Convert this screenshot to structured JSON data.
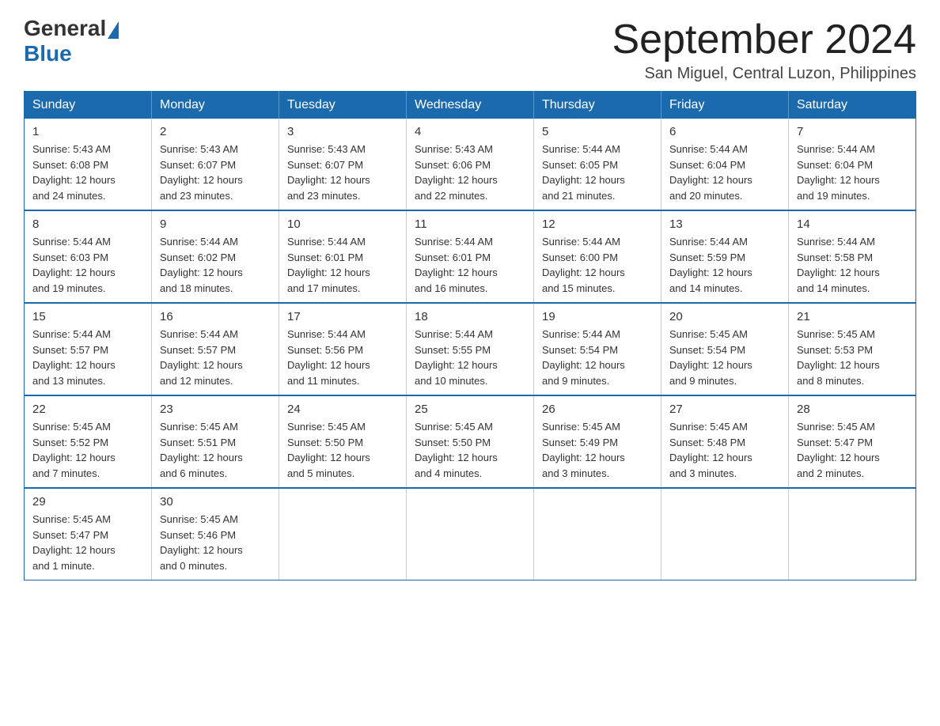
{
  "logo": {
    "general": "General",
    "blue": "Blue"
  },
  "title": "September 2024",
  "location": "San Miguel, Central Luzon, Philippines",
  "weekdays": [
    "Sunday",
    "Monday",
    "Tuesday",
    "Wednesday",
    "Thursday",
    "Friday",
    "Saturday"
  ],
  "weeks": [
    [
      {
        "day": "1",
        "sunrise": "5:43 AM",
        "sunset": "6:08 PM",
        "daylight": "12 hours and 24 minutes."
      },
      {
        "day": "2",
        "sunrise": "5:43 AM",
        "sunset": "6:07 PM",
        "daylight": "12 hours and 23 minutes."
      },
      {
        "day": "3",
        "sunrise": "5:43 AM",
        "sunset": "6:07 PM",
        "daylight": "12 hours and 23 minutes."
      },
      {
        "day": "4",
        "sunrise": "5:43 AM",
        "sunset": "6:06 PM",
        "daylight": "12 hours and 22 minutes."
      },
      {
        "day": "5",
        "sunrise": "5:44 AM",
        "sunset": "6:05 PM",
        "daylight": "12 hours and 21 minutes."
      },
      {
        "day": "6",
        "sunrise": "5:44 AM",
        "sunset": "6:04 PM",
        "daylight": "12 hours and 20 minutes."
      },
      {
        "day": "7",
        "sunrise": "5:44 AM",
        "sunset": "6:04 PM",
        "daylight": "12 hours and 19 minutes."
      }
    ],
    [
      {
        "day": "8",
        "sunrise": "5:44 AM",
        "sunset": "6:03 PM",
        "daylight": "12 hours and 19 minutes."
      },
      {
        "day": "9",
        "sunrise": "5:44 AM",
        "sunset": "6:02 PM",
        "daylight": "12 hours and 18 minutes."
      },
      {
        "day": "10",
        "sunrise": "5:44 AM",
        "sunset": "6:01 PM",
        "daylight": "12 hours and 17 minutes."
      },
      {
        "day": "11",
        "sunrise": "5:44 AM",
        "sunset": "6:01 PM",
        "daylight": "12 hours and 16 minutes."
      },
      {
        "day": "12",
        "sunrise": "5:44 AM",
        "sunset": "6:00 PM",
        "daylight": "12 hours and 15 minutes."
      },
      {
        "day": "13",
        "sunrise": "5:44 AM",
        "sunset": "5:59 PM",
        "daylight": "12 hours and 14 minutes."
      },
      {
        "day": "14",
        "sunrise": "5:44 AM",
        "sunset": "5:58 PM",
        "daylight": "12 hours and 14 minutes."
      }
    ],
    [
      {
        "day": "15",
        "sunrise": "5:44 AM",
        "sunset": "5:57 PM",
        "daylight": "12 hours and 13 minutes."
      },
      {
        "day": "16",
        "sunrise": "5:44 AM",
        "sunset": "5:57 PM",
        "daylight": "12 hours and 12 minutes."
      },
      {
        "day": "17",
        "sunrise": "5:44 AM",
        "sunset": "5:56 PM",
        "daylight": "12 hours and 11 minutes."
      },
      {
        "day": "18",
        "sunrise": "5:44 AM",
        "sunset": "5:55 PM",
        "daylight": "12 hours and 10 minutes."
      },
      {
        "day": "19",
        "sunrise": "5:44 AM",
        "sunset": "5:54 PM",
        "daylight": "12 hours and 9 minutes."
      },
      {
        "day": "20",
        "sunrise": "5:45 AM",
        "sunset": "5:54 PM",
        "daylight": "12 hours and 9 minutes."
      },
      {
        "day": "21",
        "sunrise": "5:45 AM",
        "sunset": "5:53 PM",
        "daylight": "12 hours and 8 minutes."
      }
    ],
    [
      {
        "day": "22",
        "sunrise": "5:45 AM",
        "sunset": "5:52 PM",
        "daylight": "12 hours and 7 minutes."
      },
      {
        "day": "23",
        "sunrise": "5:45 AM",
        "sunset": "5:51 PM",
        "daylight": "12 hours and 6 minutes."
      },
      {
        "day": "24",
        "sunrise": "5:45 AM",
        "sunset": "5:50 PM",
        "daylight": "12 hours and 5 minutes."
      },
      {
        "day": "25",
        "sunrise": "5:45 AM",
        "sunset": "5:50 PM",
        "daylight": "12 hours and 4 minutes."
      },
      {
        "day": "26",
        "sunrise": "5:45 AM",
        "sunset": "5:49 PM",
        "daylight": "12 hours and 3 minutes."
      },
      {
        "day": "27",
        "sunrise": "5:45 AM",
        "sunset": "5:48 PM",
        "daylight": "12 hours and 3 minutes."
      },
      {
        "day": "28",
        "sunrise": "5:45 AM",
        "sunset": "5:47 PM",
        "daylight": "12 hours and 2 minutes."
      }
    ],
    [
      {
        "day": "29",
        "sunrise": "5:45 AM",
        "sunset": "5:47 PM",
        "daylight": "12 hours and 1 minute."
      },
      {
        "day": "30",
        "sunrise": "5:45 AM",
        "sunset": "5:46 PM",
        "daylight": "12 hours and 0 minutes."
      },
      null,
      null,
      null,
      null,
      null
    ]
  ],
  "labels": {
    "sunrise": "Sunrise:",
    "sunset": "Sunset:",
    "daylight": "Daylight:"
  }
}
